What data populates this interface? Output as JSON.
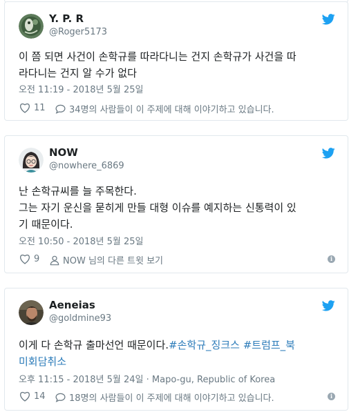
{
  "tweets": [
    {
      "name": "Y. P. R",
      "handle": "@Roger5173",
      "text_lines": [
        "이 쯤 되면 사건이 손학규를 따라다니는 건지 손학규가 사건을 따",
        "라다니는 건지 알 수가 없다"
      ],
      "timestamp": "오전 11:19 - 2018년 5월 25일",
      "likes": "11",
      "secondary_action": "34명의 사람들이 이 주제에 대해 이야기하고 있습니다."
    },
    {
      "name": "NOW",
      "handle": "@nowhere_6869",
      "text_lines": [
        "난 손학규씨를 늘 주목한다.",
        "그는 자기 운신을 묻히게 만들 대형 이슈를 예지하는 신통력이 있",
        "기 때문이다."
      ],
      "timestamp": "오전 10:50 - 2018년 5월 25일",
      "likes": "9",
      "secondary_action": "NOW 님의 다른 트윗 보기"
    },
    {
      "name": "Aeneias",
      "handle": "@goldmine93",
      "text_line1_plain": "이게 다 손학규 출마선언 때문이다.",
      "text_line1_tag1": "#손학규_징크스",
      "text_line1_tag2": "#트럼프_북",
      "text_line2_tag": "미회담취소",
      "timestamp": "오후 11:15 - 2018년 5월 24일",
      "location": "Mapo-gu, Republic of Korea",
      "likes": "14",
      "secondary_action": "18명의 사람들이 이 주제에 대해 이야기하고 있습니다."
    }
  ],
  "icons": {
    "twitter_bird": "twitter-bird-icon",
    "like": "heart-icon",
    "conversation": "speech-bubble-icon",
    "profile": "person-icon",
    "info": "info-icon"
  },
  "info_glyph": "i",
  "separator": " · ",
  "colors": {
    "twitter_blue": "#1da1f2",
    "hashtag": "#2b7bb9",
    "meta_gray": "#697882",
    "border": "#e1e8ed"
  }
}
